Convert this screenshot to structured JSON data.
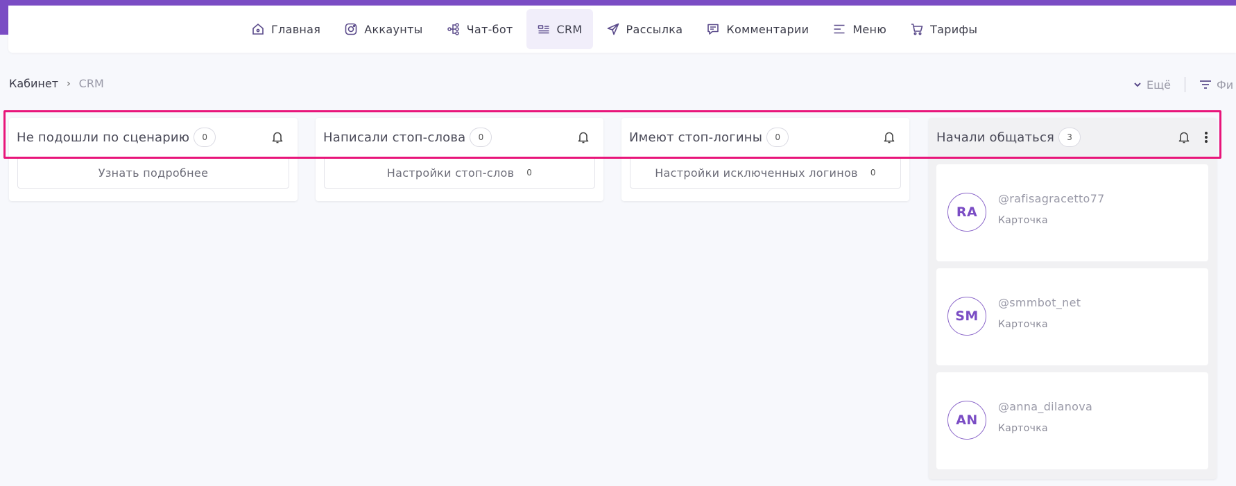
{
  "colors": {
    "accent": "#7a4cc4",
    "highlight": "#e8157a",
    "background": "#f7f8fc"
  },
  "nav": {
    "items": [
      {
        "label": "Главная",
        "icon": "home-icon",
        "active": false
      },
      {
        "label": "Аккаунты",
        "icon": "instagram-icon",
        "active": false
      },
      {
        "label": "Чат-бот",
        "icon": "flow-icon",
        "active": false
      },
      {
        "label": "CRM",
        "icon": "crm-icon",
        "active": true
      },
      {
        "label": "Рассылка",
        "icon": "send-icon",
        "active": false
      },
      {
        "label": "Комментарии",
        "icon": "comment-icon",
        "active": false
      },
      {
        "label": "Меню",
        "icon": "menu-icon",
        "active": false
      },
      {
        "label": "Тарифы",
        "icon": "cart-icon",
        "active": false
      }
    ]
  },
  "breadcrumb": {
    "home": "Кабинет",
    "separator": "›",
    "current": "CRM"
  },
  "toolbar": {
    "more_label": "Ещё",
    "filter_label": "Фи"
  },
  "columns": [
    {
      "title": "Не подошли по сценарию",
      "count": "0",
      "action_label": "Узнать подробнее",
      "action_count": ""
    },
    {
      "title": "Написали стоп-слова",
      "count": "0",
      "action_label": "Настройки стоп-слов",
      "action_count": "0"
    },
    {
      "title": "Имеют стоп-логины",
      "count": "0",
      "action_label": "Настройки исключенных логинов",
      "action_count": "0"
    },
    {
      "title": "Начали общаться",
      "count": "3"
    }
  ],
  "cards": [
    {
      "initials": "RA",
      "username": "@rafisagracetto77",
      "subtitle": "Карточка"
    },
    {
      "initials": "SM",
      "username": "@smmbot_net",
      "subtitle": "Карточка"
    },
    {
      "initials": "AN",
      "username": "@anna_dilanova",
      "subtitle": "Карточка"
    }
  ]
}
